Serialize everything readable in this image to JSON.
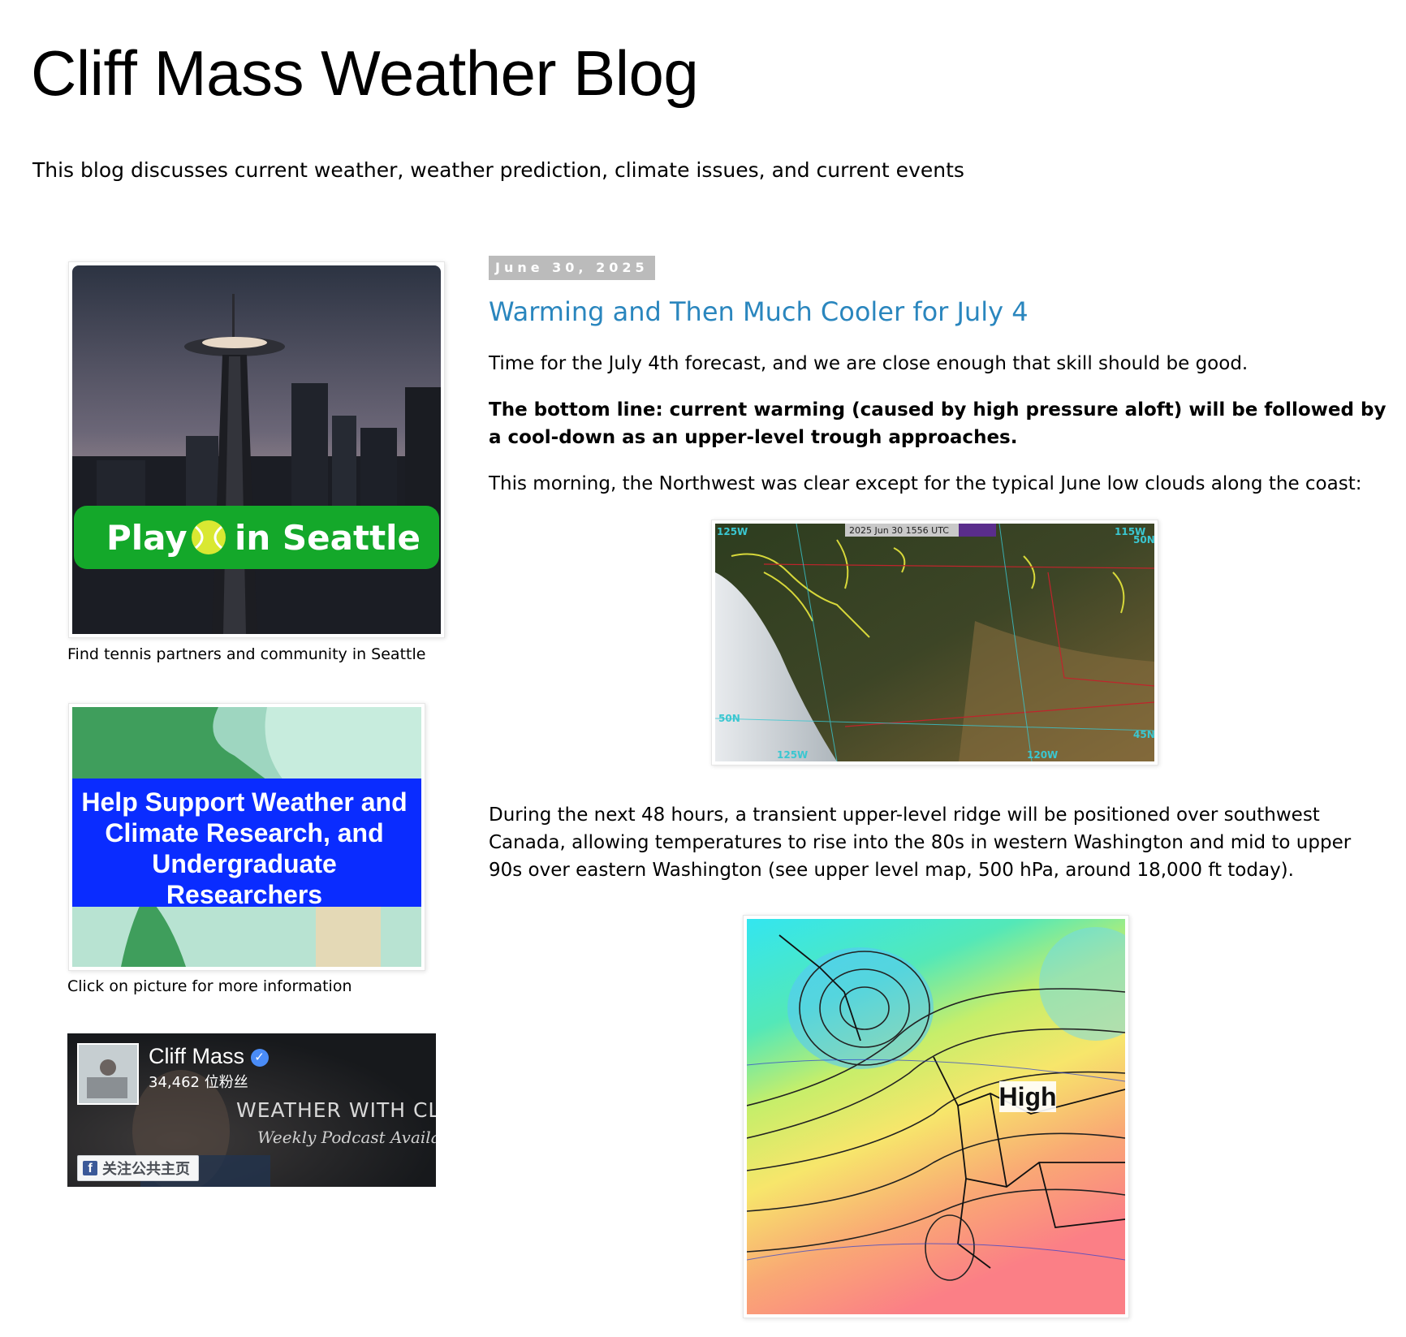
{
  "blog": {
    "title": "Cliff Mass Weather Blog",
    "description": "This blog discusses current weather, weather prediction, climate issues, and current events"
  },
  "sidebar": {
    "tennis_ad": {
      "banner_text_play": "Play",
      "banner_text_seattle": "in Seattle",
      "caption": "Find tennis partners and community in Seattle",
      "banner_color": "#14a82a"
    },
    "support_ad": {
      "banner_lines": [
        "Help Support Weather and",
        "Climate Research, and",
        "Undergraduate",
        "Researchers"
      ],
      "caption": "Click on picture for more information",
      "banner_color": "#0a2cff"
    },
    "facebook_widget": {
      "page_name": "Cliff Mass",
      "follower_count": "34,462 位粉丝",
      "cover_line1": "WEATHER WITH CLIF",
      "cover_line2": "Weekly Podcast Availa",
      "follow_button": "关注公共主页",
      "verified_icon": "verified-check-icon",
      "fb_icon": "facebook-icon"
    }
  },
  "post": {
    "date": "June 30, 2025",
    "title": "Warming and Then Much Cooler for July 4",
    "p1": "Time for the July 4th forecast, and we are close enough that skill should be good.",
    "p2": "The bottom line:  current warming (caused by high pressure aloft) will be followed by a cool-down as an upper-level trough approaches.",
    "p3": "This morning, the Northwest was clear except for the typical June low clouds along the coast:",
    "satellite": {
      "timestamp": "2025 Jun 30 1556 UTC",
      "labels": [
        "125W",
        "115W",
        "50N",
        "45N",
        "120W",
        "125W",
        "50N"
      ]
    },
    "p4": "During the next 48 hours, a transient upper-level ridge will be positioned over southwest Canada, allowing temperatures to rise into the 80s in western Washington and mid to upper 90s over eastern Washington (see upper level map, 500 hPa, around 18,000 ft today).",
    "upper_map": {
      "high_label": "High"
    }
  }
}
